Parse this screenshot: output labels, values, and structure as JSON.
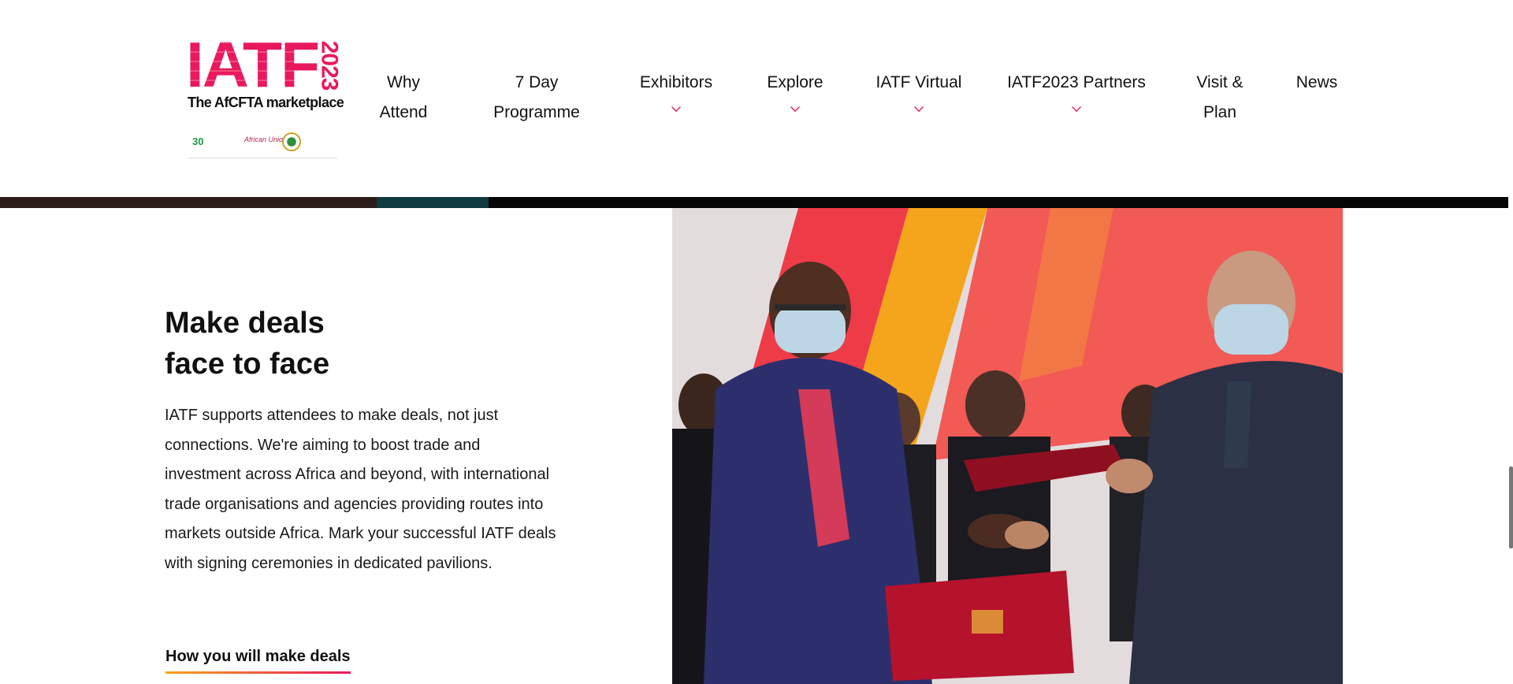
{
  "brand": {
    "name": "IATF",
    "year": "2023",
    "tagline": "The AfCFTA marketplace",
    "partner_badge": "30",
    "partner_au": "African Union"
  },
  "nav": {
    "items": [
      {
        "label": "Why Attend",
        "dropdown": false
      },
      {
        "label": "7 Day Programme",
        "dropdown": false
      },
      {
        "label": "Exhibitors",
        "dropdown": true
      },
      {
        "label": "Explore",
        "dropdown": true
      },
      {
        "label": "IATF Virtual",
        "dropdown": true
      },
      {
        "label": "IATF2023 Partners",
        "dropdown": true
      },
      {
        "label": "Visit & Plan",
        "dropdown": false
      },
      {
        "label": "News",
        "dropdown": false
      }
    ]
  },
  "section": {
    "title": "Make deals\nface to face",
    "body": "IATF supports attendees to make deals, not just connections. We're aiming to boost trade and investment across Africa and beyond, with international trade organisations and agencies providing routes into markets outside Africa. Mark your successful IATF deals with signing ceremonies in dedicated pavilions.",
    "cta": "How you will make deals"
  },
  "colors": {
    "accent": "#e8195f",
    "cta_gradient_start": "#f6a31d",
    "cta_gradient_end": "#e8195f"
  },
  "icons": {
    "dropdown": "chevron-down-icon"
  }
}
